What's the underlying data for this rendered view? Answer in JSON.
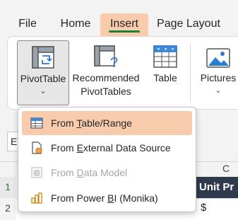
{
  "menubar": {
    "tabs": [
      {
        "label": "File"
      },
      {
        "label": "Home"
      },
      {
        "label": "Insert",
        "active": true
      },
      {
        "label": "Page Layout"
      }
    ]
  },
  "ribbon": {
    "pivot_table": {
      "label": "PivotTable"
    },
    "recommended": {
      "label_line1": "Recommended",
      "label_line2": "PivotTables"
    },
    "table": {
      "label": "Table"
    },
    "pictures": {
      "label": "Pictures"
    }
  },
  "dropdown": {
    "items": [
      {
        "prefix": "From ",
        "key": "T",
        "rest": "able/Range",
        "selected": true,
        "enabled": true,
        "icon": "table-range-icon"
      },
      {
        "prefix": "From ",
        "key": "E",
        "rest": "xternal Data Source",
        "selected": false,
        "enabled": true,
        "icon": "external-data-icon"
      },
      {
        "prefix": "From ",
        "key": "D",
        "rest": "ata Model",
        "selected": false,
        "enabled": false,
        "icon": "data-model-icon"
      },
      {
        "prefix": "From Power ",
        "key": "B",
        "rest": "I (Monika)",
        "selected": false,
        "enabled": true,
        "icon": "power-bi-icon"
      }
    ]
  },
  "sheet": {
    "namebox_text": "E",
    "column_c": "C",
    "row1": "1",
    "row2": "2",
    "header_cell": "Unit Pr",
    "cell_value": "$"
  },
  "colors": {
    "accent_tab": "#f8cbad",
    "tab_underline": "#1a7f37",
    "header_cell_bg": "#2f3b4c"
  }
}
